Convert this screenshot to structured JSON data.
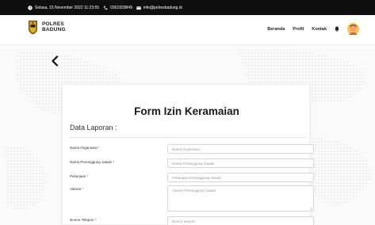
{
  "topbar": {
    "datetime": "Selasa, 15 November 2022 11:23:55",
    "phone": "0361829849",
    "email": "info@polresbadung.id"
  },
  "brand": {
    "line1": "POLRES",
    "line2": "BADUNG"
  },
  "nav": {
    "items": [
      "Beranda",
      "Profil",
      "Kontak"
    ]
  },
  "form": {
    "title": "Form Izin Keramaian",
    "section": "Data Laporan :",
    "required_mark": "*",
    "fields": [
      {
        "label": "Nama Organisasi",
        "placeholder": "Nama Organisasi"
      },
      {
        "label": "Nama Penanggung Jawab",
        "placeholder": "Nama Penanggung Jawab"
      },
      {
        "label": "Pekerjaan",
        "placeholder": "Pekerjaan Penanggung Jawab"
      },
      {
        "label": "Alamat",
        "placeholder": "Alamat Penanggung Jawab"
      },
      {
        "label": "Nomor Telepon",
        "placeholder": "Nomor telepon"
      }
    ]
  }
}
